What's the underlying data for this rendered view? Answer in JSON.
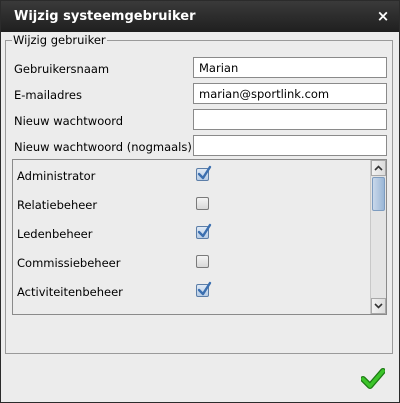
{
  "dialog": {
    "title": "Wijzig systeemgebruiker",
    "close_glyph": "×"
  },
  "form": {
    "legend": "Wijzig gebruiker",
    "fields": [
      {
        "label": "Gebruikersnaam",
        "value": "Marian"
      },
      {
        "label": "E-mailadres",
        "value": "marian@sportlink.com"
      },
      {
        "label": "Nieuw wachtwoord",
        "value": ""
      },
      {
        "label": "Nieuw wachtwoord (nogmaals)",
        "value": ""
      }
    ],
    "roles": [
      {
        "label": "Administrator",
        "checked": true
      },
      {
        "label": "Relatiebeheer",
        "checked": false
      },
      {
        "label": "Ledenbeheer",
        "checked": true
      },
      {
        "label": "Commissiebeheer",
        "checked": false
      },
      {
        "label": "Activiteitenbeheer",
        "checked": true
      }
    ]
  },
  "icons": {
    "close": "close-icon",
    "confirm": "checkmark-icon",
    "scroll_up": "chevron-up-icon",
    "scroll_down": "chevron-down-icon"
  },
  "colors": {
    "titlebar": "#2a2a2a",
    "confirm_green": "#2eab1f",
    "checkbox_check": "#3b6fb0"
  }
}
